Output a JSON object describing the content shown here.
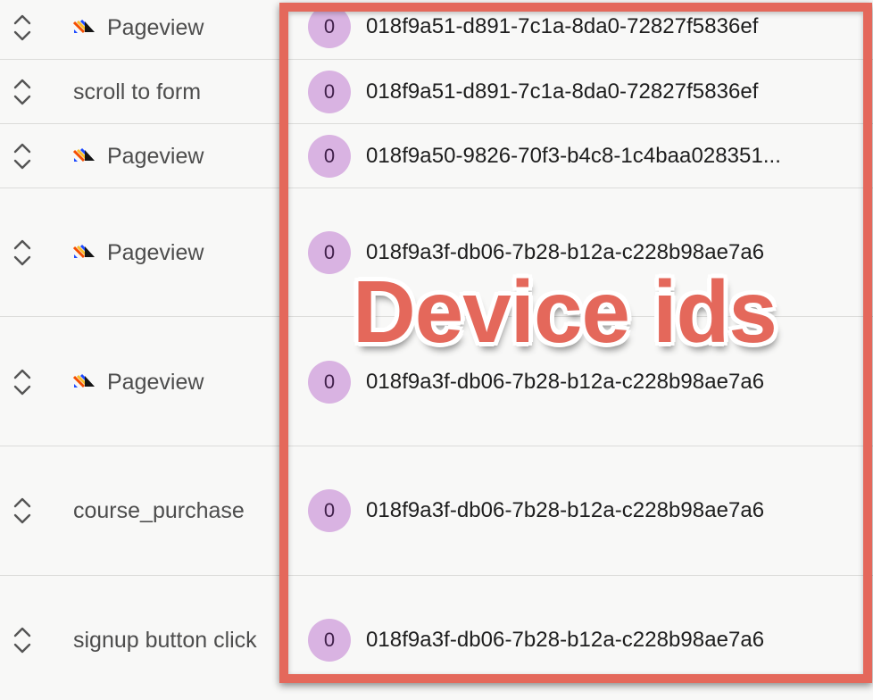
{
  "rows": [
    {
      "event": "Pageview",
      "has_logo": true,
      "person_initial": "0",
      "device_id": "018f9a51-d891-7c1a-8da0-72827f5836ef"
    },
    {
      "event": "scroll to form",
      "has_logo": false,
      "person_initial": "0",
      "device_id": "018f9a51-d891-7c1a-8da0-72827f5836ef"
    },
    {
      "event": "Pageview",
      "has_logo": true,
      "person_initial": "0",
      "device_id": "018f9a50-9826-70f3-b4c8-1c4baa028351..."
    },
    {
      "event": "Pageview",
      "has_logo": true,
      "person_initial": "0",
      "device_id": "018f9a3f-db06-7b28-b12a-c228b98ae7a6"
    },
    {
      "event": "Pageview",
      "has_logo": true,
      "person_initial": "0",
      "device_id": "018f9a3f-db06-7b28-b12a-c228b98ae7a6"
    },
    {
      "event": "course_purchase",
      "has_logo": false,
      "person_initial": "0",
      "device_id": "018f9a3f-db06-7b28-b12a-c228b98ae7a6"
    },
    {
      "event": "signup button click",
      "has_logo": false,
      "person_initial": "0",
      "device_id": "018f9a3f-db06-7b28-b12a-c228b98ae7a6"
    }
  ],
  "annotation": {
    "label": "Device ids",
    "color": "#e4685b"
  },
  "icons": {
    "expand": "chevron-up-down-icon",
    "logo": "posthog-logo-icon"
  },
  "colors": {
    "avatar_bg": "#d9b3e2",
    "avatar_text": "#40204a",
    "row_divider": "#dcdcda",
    "background": "#f8f8f7"
  }
}
